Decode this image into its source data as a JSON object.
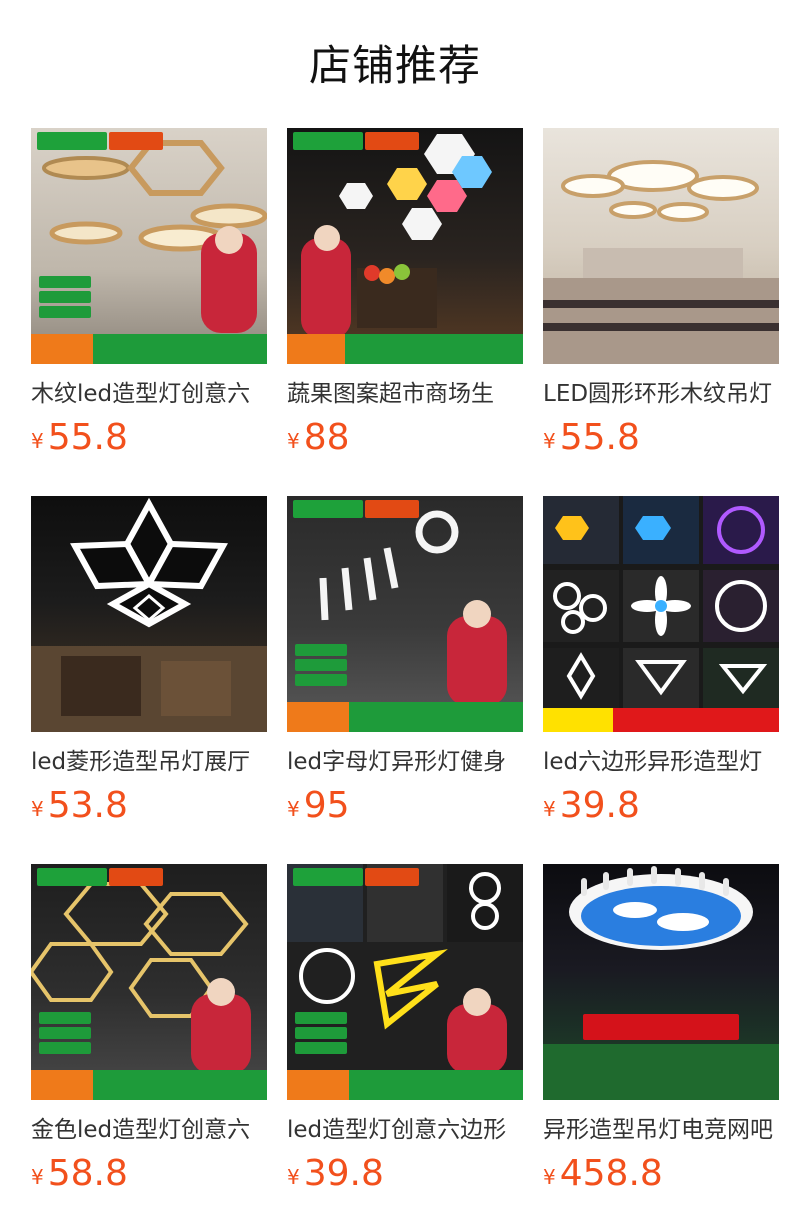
{
  "page": {
    "title": "店铺推荐"
  },
  "colors": {
    "price": "#f2501c",
    "title": "#111111",
    "name": "#333333"
  },
  "products": [
    {
      "name": "木纹led造型灯创意六",
      "currency": "¥",
      "price": "55.8",
      "image": "wood-hexagon-pendant-lights"
    },
    {
      "name": "蔬果图案超市商场生",
      "currency": "¥",
      "price": "88",
      "image": "fruit-pattern-supermarket-lights"
    },
    {
      "name": "LED圆形环形木纹吊灯",
      "currency": "¥",
      "price": "55.8",
      "image": "round-ring-wood-pendant-lights"
    },
    {
      "name": "led菱形造型吊灯展厅",
      "currency": "¥",
      "price": "53.8",
      "image": "diamond-shape-pendant-light"
    },
    {
      "name": "led字母灯异形灯健身",
      "currency": "¥",
      "price": "95",
      "image": "letter-shaped-gym-light"
    },
    {
      "name": "led六边形异形造型灯",
      "currency": "¥",
      "price": "39.8",
      "image": "hexagon-custom-shape-lights"
    },
    {
      "name": "金色led造型灯创意六",
      "currency": "¥",
      "price": "58.8",
      "image": "gold-hexagon-lights"
    },
    {
      "name": "led造型灯创意六边形",
      "currency": "¥",
      "price": "39.8",
      "image": "creative-led-shape-lights"
    },
    {
      "name": "异形造型吊灯电竞网吧",
      "currency": "¥",
      "price": "458.8",
      "image": "starry-sky-billiards-light"
    }
  ]
}
